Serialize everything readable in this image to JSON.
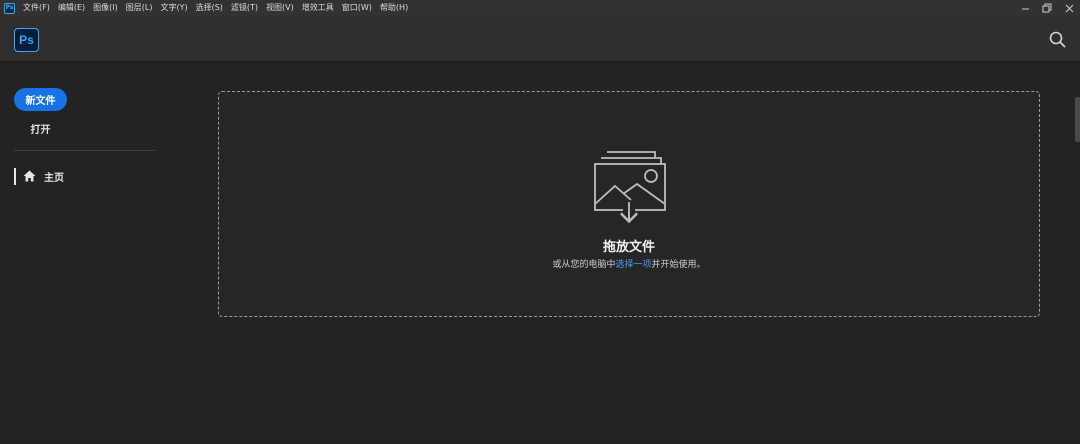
{
  "menubar": {
    "app_icon": "Ps",
    "items": [
      "文件(F)",
      "编辑(E)",
      "图像(I)",
      "图层(L)",
      "文字(Y)",
      "选择(S)",
      "滤镜(T)",
      "视图(V)",
      "增效工具",
      "窗口(W)",
      "帮助(H)"
    ]
  },
  "header": {
    "logo": "Ps"
  },
  "sidebar": {
    "new_file": "新文件",
    "open": "打开",
    "nav_home": "主页"
  },
  "dropzone": {
    "title": "拖放文件",
    "subtitle_pre": "或从您的电脑中",
    "subtitle_link": "选择一项",
    "subtitle_post": "并开始使用。"
  },
  "colors": {
    "accent": "#1473e6",
    "link": "#4b9cf5",
    "ps_blue": "#31a8ff"
  },
  "icons": [
    "search-icon",
    "home-icon",
    "minimize-icon",
    "restore-icon",
    "close-icon",
    "image-drop-icon"
  ]
}
